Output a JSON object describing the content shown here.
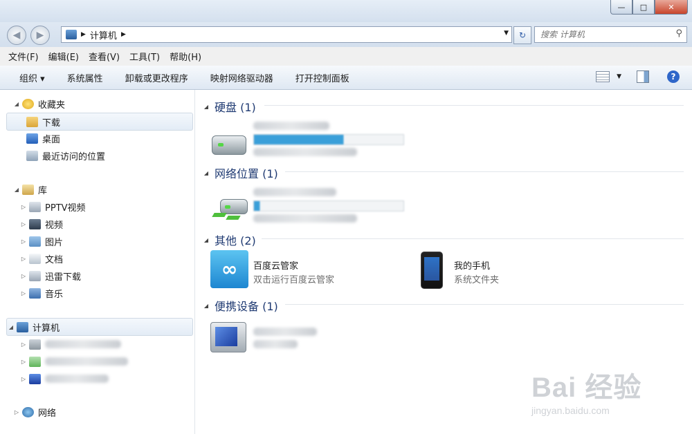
{
  "window": {
    "minimize": "—",
    "maximize": "□",
    "close": "✕"
  },
  "address": {
    "path": "计算机",
    "search_placeholder": "搜索 计算机"
  },
  "menu": [
    "文件(F)",
    "编辑(E)",
    "查看(V)",
    "工具(T)",
    "帮助(H)"
  ],
  "commands": {
    "organize": "组织 ▾",
    "items": [
      "系统属性",
      "卸载或更改程序",
      "映射网络驱动器",
      "打开控制面板"
    ],
    "help": "?"
  },
  "nav": {
    "favorites": "收藏夹",
    "downloads": "下载",
    "desktop": "桌面",
    "recent": "最近访问的位置",
    "libraries": "库",
    "pptv": "PPTV视频",
    "video": "视频",
    "pictures": "图片",
    "documents": "文档",
    "thunder": "迅雷下载",
    "music": "音乐",
    "computer": "计算机",
    "network": "网络"
  },
  "groups": {
    "hdd": "硬盘 (1)",
    "netloc": "网络位置 (1)",
    "other": "其他 (2)",
    "portable": "便携设备 (1)"
  },
  "other_items": [
    {
      "title": "百度云管家",
      "subtitle": "双击运行百度云管家"
    },
    {
      "title": "我的手机",
      "subtitle": "系统文件夹"
    }
  ],
  "watermark": {
    "main": "Bai 经验",
    "url": "jingyan.baidu.com"
  },
  "colors": {
    "accent": "#2e66c9",
    "group_heading": "#1f3a72"
  }
}
